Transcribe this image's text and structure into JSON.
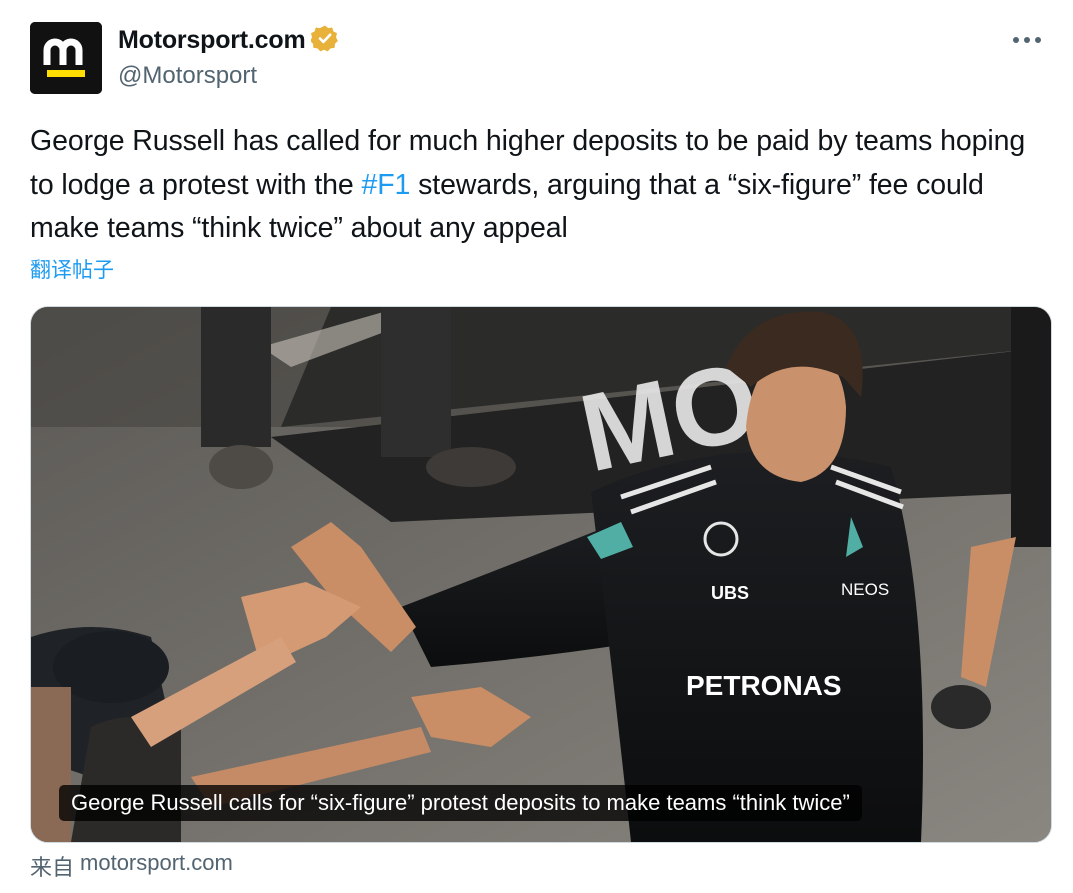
{
  "account": {
    "display_name": "Motorsport.com",
    "handle": "@Motorsport",
    "verified_badge": "gold-verified-badge-icon",
    "avatar_icon": "motorsport-logo-icon"
  },
  "tweet": {
    "text_before_hashtag": "George Russell has called for much higher deposits to be paid by teams hoping to lodge a protest with the ",
    "hashtag": "#F1",
    "text_after_hashtag": " stewards, arguing that a “six-figure” fee could make teams “think twice” about any appeal",
    "translate_label": "翻译帖子"
  },
  "link_card": {
    "caption": "George Russell calls for “six-figure” protest deposits to make teams “think twice”",
    "source_prefix": "来自",
    "source_domain": "motorsport.com"
  },
  "photo_text": {
    "ground_lettering": "MOT",
    "suit_sponsor_main": "PETRONAS",
    "suit_sponsor_ubs": "UBS",
    "suit_sponsor_neos": "NEOS"
  },
  "menu": {
    "more_icon": "more-horizontal-icon"
  },
  "colors": {
    "link": "#1d9bf0",
    "secondary_text": "#536471",
    "brand_yellow": "#ffde00",
    "verified_gold": "#e8b23a"
  }
}
